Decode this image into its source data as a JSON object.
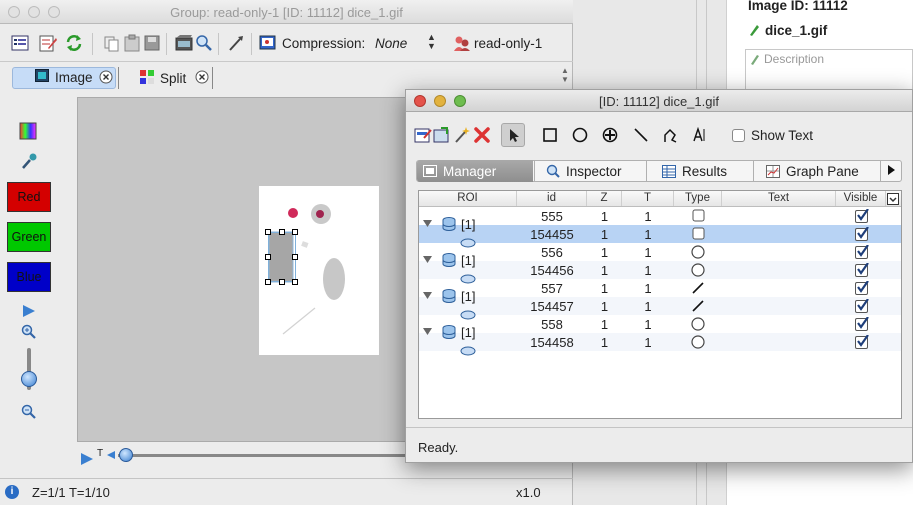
{
  "back_window": {
    "title": "Group: read-only-1 [ID: 11112] dice_1.gif",
    "toolbar": {
      "compression_label": "Compression:",
      "compression_value": "None",
      "group_label": "read-only-1"
    },
    "tabs": [
      {
        "label": "Image"
      },
      {
        "label": "Split"
      }
    ],
    "channels": [
      {
        "label": "Red",
        "color": "#d40000"
      },
      {
        "label": "Green",
        "color": "#00c800"
      },
      {
        "label": "Blue",
        "color": "#0000c8"
      }
    ],
    "slider_label": "T",
    "status": {
      "position": "Z=1/1 T=1/10",
      "zoom": "x1.0"
    }
  },
  "right_panel": {
    "image_id": "Image ID: 11112",
    "filename": "dice_1.gif",
    "description_placeholder": "Description"
  },
  "roi_window": {
    "title": "[ID: 11112] dice_1.gif",
    "show_text_label": "Show Text",
    "tabs": [
      {
        "label": "Manager",
        "active": true
      },
      {
        "label": "Inspector"
      },
      {
        "label": "Results"
      },
      {
        "label": "Graph Pane"
      }
    ],
    "columns": [
      "ROI",
      "id",
      "Z",
      "T",
      "Type",
      "Text",
      "Visible"
    ],
    "rows": [
      {
        "roi": "[1]",
        "id": "555",
        "z": "1",
        "t": "1",
        "type": "rectangle",
        "text": "",
        "visible": true,
        "parent": true
      },
      {
        "roi": "",
        "id": "154455",
        "z": "1",
        "t": "1",
        "type": "rectangle",
        "text": "",
        "visible": true,
        "parent": false,
        "selected": true
      },
      {
        "roi": "[1]",
        "id": "556",
        "z": "1",
        "t": "1",
        "type": "ellipse",
        "text": "",
        "visible": true,
        "parent": true
      },
      {
        "roi": "",
        "id": "154456",
        "z": "1",
        "t": "1",
        "type": "ellipse",
        "text": "",
        "visible": true,
        "parent": false
      },
      {
        "roi": "[1]",
        "id": "557",
        "z": "1",
        "t": "1",
        "type": "line",
        "text": "",
        "visible": true,
        "parent": true
      },
      {
        "roi": "",
        "id": "154457",
        "z": "1",
        "t": "1",
        "type": "line",
        "text": "",
        "visible": true,
        "parent": false
      },
      {
        "roi": "[1]",
        "id": "558",
        "z": "1",
        "t": "1",
        "type": "ellipse",
        "text": "",
        "visible": true,
        "parent": true
      },
      {
        "roi": "",
        "id": "154458",
        "z": "1",
        "t": "1",
        "type": "ellipse",
        "text": "",
        "visible": true,
        "parent": false
      }
    ],
    "status": "Ready."
  }
}
